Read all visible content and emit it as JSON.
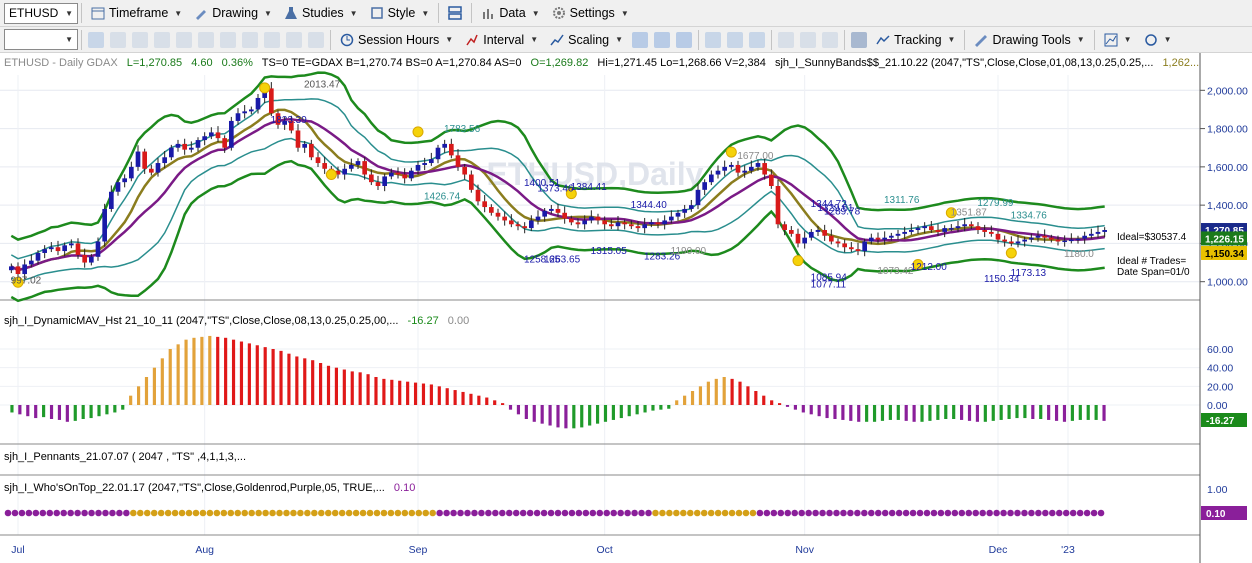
{
  "toolbar1": {
    "symbol": "ETHUSD",
    "timeframe": "Timeframe",
    "drawing": "Drawing",
    "studies": "Studies",
    "style": "Style",
    "data": "Data",
    "settings": "Settings"
  },
  "toolbar2": {
    "session_hours": "Session Hours",
    "interval": "Interval",
    "scaling": "Scaling",
    "tracking": "Tracking",
    "drawing_tools": "Drawing Tools"
  },
  "header": {
    "symbol_line": "ETHUSD - Daily  GDAX",
    "last": "L=1,270.85",
    "change": "4.60",
    "change_pct": "0.36%",
    "rest": "TS=0  TE=GDAX  B=1,270.74  BS=0  A=1,270.84  AS=0",
    "open": "O=1,269.82",
    "hilo": "Hi=1,271.45  Lo=1,268.66  V=2,384",
    "study": "sjh_I_SunnyBands$$_21.10.22 (2047,\"TS\",Close,Close,01,08,13,0.25,0.25,...",
    "study_val": "1,262..."
  },
  "watermark": "ETHUSD,Daily",
  "pane2_title": "sjh_I_DynamicMAV_Hst 21_10_11 (2047,\"TS\",Close,Close,08,13,0.25,0.25,00,...",
  "pane2_vals": [
    "-16.27",
    "0.00"
  ],
  "pane3_title": "sjh_I_Pennants_21.07.07 ( 2047 , \"TS\" ,4,1,1,3,...",
  "pane4_title": "sjh_I_Who'sOnTop_22.01.17 (2047,\"TS\",Close,Goldenrod,Purple,05, TRUE,...",
  "pane4_val": "0.10",
  "ideal_text": [
    "Ideal=$30537.4",
    "Ideal # Trades=",
    "Date Span=01/0"
  ],
  "price_labels": [
    "997.02",
    "2013.47",
    "1823.39",
    "1783.56",
    "1426.74",
    "1400.51",
    "1373.46",
    "1384.41",
    "1258.65",
    "1263.65",
    "1315.05",
    "1344.40",
    "1283.26",
    "1190.00",
    "1677.00",
    "1344.72",
    "1329.61",
    "1289.78",
    "1085.94",
    "1077.11",
    "1311.76",
    "1073.42",
    "1212.00",
    "1279.99",
    "1351.87",
    "1334.76",
    "1150.34",
    "1173.13",
    "1180.0"
  ],
  "colors": {
    "up_candle": "#1a1aa8",
    "down_candle": "#d81a1a",
    "band_green": "#1d8a1d",
    "band_teal": "#2a8e8e",
    "ma_olive": "#8b7d1e",
    "ma_purple": "#7a1a86",
    "hist_red": "#e01818",
    "hist_gold": "#e2a23a",
    "hist_green": "#1f9a2a",
    "hist_purple": "#8a1f9a",
    "price_axis_text": "#1f3a9a"
  },
  "chart_data": [
    {
      "type": "candlestick",
      "title": "ETHUSD - Daily GDAX",
      "x_labels": [
        "Jul",
        "Aug",
        "Sep",
        "Oct",
        "Nov",
        "Dec",
        "'23"
      ],
      "y_ticks": [
        "1,000.00",
        "1,200.00",
        "1,400.00",
        "1,600.00",
        "1,800.00",
        "2,000.00"
      ],
      "ylim": [
        920,
        2080
      ],
      "last_price": "1,270.85",
      "axis_tags": [
        "1,270.85",
        "1,150.34",
        "1,226.15"
      ],
      "close_series": [
        1080,
        1040,
        1090,
        1110,
        1150,
        1170,
        1180,
        1160,
        1190,
        1200,
        1140,
        1100,
        1130,
        1210,
        1380,
        1470,
        1520,
        1540,
        1600,
        1680,
        1590,
        1570,
        1620,
        1650,
        1700,
        1720,
        1690,
        1700,
        1740,
        1760,
        1780,
        1750,
        1700,
        1840,
        1880,
        1890,
        1900,
        1960,
        2010,
        1880,
        1820,
        1840,
        1790,
        1700,
        1720,
        1650,
        1620,
        1590,
        1580,
        1560,
        1590,
        1610,
        1630,
        1560,
        1520,
        1500,
        1550,
        1570,
        1560,
        1540,
        1580,
        1610,
        1620,
        1640,
        1700,
        1720,
        1660,
        1600,
        1560,
        1480,
        1420,
        1390,
        1360,
        1340,
        1320,
        1300,
        1290,
        1280,
        1320,
        1340,
        1370,
        1380,
        1360,
        1330,
        1310,
        1300,
        1320,
        1340,
        1320,
        1300,
        1290,
        1310,
        1300,
        1290,
        1280,
        1300,
        1310,
        1300,
        1320,
        1340,
        1360,
        1380,
        1400,
        1480,
        1520,
        1560,
        1580,
        1600,
        1610,
        1570,
        1580,
        1600,
        1620,
        1560,
        1500,
        1300,
        1270,
        1250,
        1200,
        1230,
        1260,
        1270,
        1240,
        1210,
        1200,
        1180,
        1170,
        1160,
        1210,
        1230,
        1220,
        1230,
        1240,
        1250,
        1260,
        1270,
        1280,
        1290,
        1270,
        1260,
        1280,
        1280,
        1290,
        1300,
        1290,
        1270,
        1260,
        1250,
        1220,
        1210,
        1200,
        1210,
        1220,
        1230,
        1240,
        1230,
        1220,
        1210,
        1215,
        1220,
        1225,
        1240,
        1250,
        1260,
        1270
      ]
    },
    {
      "type": "bar",
      "title": "sjh_I_DynamicMAV_Hst",
      "y_ticks": [
        "0.00",
        "20.00",
        "40.00",
        "60.00"
      ],
      "ylim": [
        -45,
        75
      ],
      "last_value": "-16.27",
      "values": [
        -8,
        -10,
        -12,
        -14,
        -13,
        -15,
        -16,
        -18,
        -17,
        -15,
        -14,
        -12,
        -10,
        -8,
        -5,
        10,
        20,
        30,
        40,
        50,
        60,
        65,
        70,
        72,
        73,
        74,
        73,
        72,
        70,
        68,
        66,
        64,
        62,
        60,
        58,
        55,
        52,
        50,
        48,
        45,
        42,
        40,
        38,
        36,
        35,
        33,
        30,
        28,
        27,
        26,
        25,
        24,
        23,
        22,
        20,
        18,
        16,
        14,
        12,
        10,
        8,
        5,
        2,
        -5,
        -10,
        -15,
        -18,
        -20,
        -22,
        -24,
        -25,
        -25,
        -24,
        -22,
        -20,
        -18,
        -16,
        -14,
        -12,
        -10,
        -8,
        -6,
        -5,
        -4,
        5,
        10,
        15,
        20,
        25,
        28,
        30,
        28,
        25,
        20,
        15,
        10,
        5,
        2,
        -2,
        -5,
        -8,
        -10,
        -12,
        -14,
        -15,
        -16,
        -17,
        -18,
        -18,
        -18,
        -17,
        -16,
        -16,
        -17,
        -18,
        -18,
        -17,
        -16,
        -15,
        -15,
        -16,
        -17,
        -18,
        -18,
        -17,
        -16,
        -15,
        -14,
        -14,
        -15,
        -15,
        -16,
        -17,
        -18,
        -17,
        -16,
        -16,
        -16,
        -17
      ],
      "color_rule": "gold when rising above 0, red when falling above 0, green when rising below 0, purple when falling below 0"
    },
    {
      "type": "dots",
      "title": "sjh_I_Who'sOnTop",
      "y_ticks": [
        "1.00",
        "0.00"
      ],
      "last_value": "0.10",
      "segments": [
        {
          "from": 0,
          "to": 18,
          "color": "purple"
        },
        {
          "from": 18,
          "to": 62,
          "color": "goldenrod"
        },
        {
          "from": 62,
          "to": 93,
          "color": "purple"
        },
        {
          "from": 93,
          "to": 108,
          "color": "goldenrod"
        },
        {
          "from": 108,
          "to": 158,
          "color": "purple"
        }
      ]
    }
  ]
}
